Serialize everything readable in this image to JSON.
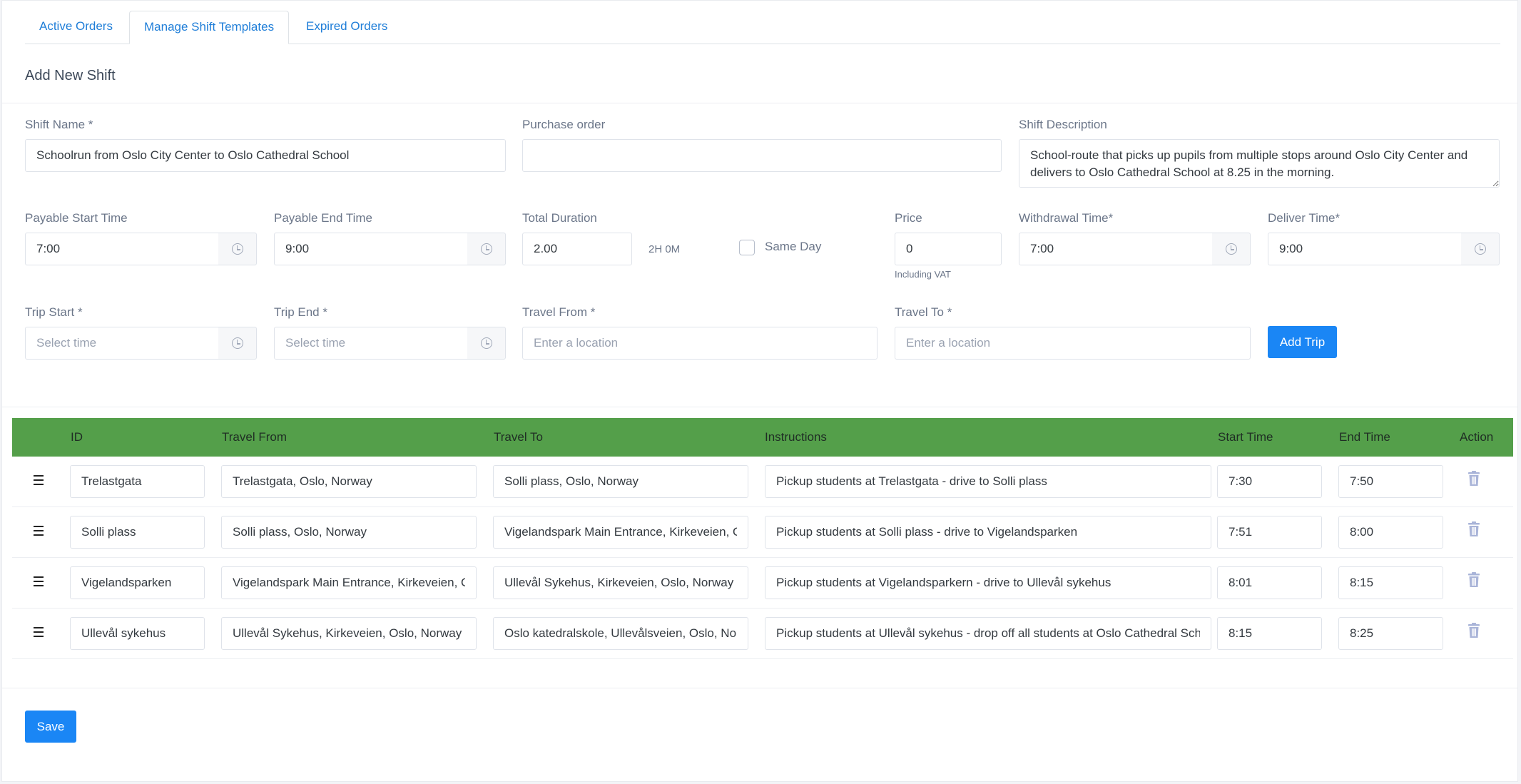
{
  "tabs": [
    {
      "label": "Active Orders",
      "active": false
    },
    {
      "label": "Manage Shift Templates",
      "active": true
    },
    {
      "label": "Expired Orders",
      "active": false
    }
  ],
  "section_title": "Add New Shift",
  "form": {
    "shift_name": {
      "label": "Shift Name *",
      "value": "Schoolrun from Oslo City Center to Oslo Cathedral School"
    },
    "purchase_order": {
      "label": "Purchase order",
      "value": ""
    },
    "shift_description": {
      "label": "Shift Description",
      "value": "School-route that picks up pupils from multiple stops around Oslo City Center and delivers to Oslo Cathedral School at 8.25 in the morning."
    },
    "payable_start": {
      "label": "Payable Start Time",
      "value": "7:00"
    },
    "payable_end": {
      "label": "Payable End Time",
      "value": "9:00"
    },
    "total_duration": {
      "label": "Total Duration",
      "value": "2.00",
      "readout": "2H 0M"
    },
    "same_day": {
      "label": "Same Day",
      "checked": false
    },
    "price": {
      "label": "Price",
      "value": "0",
      "note": "Including VAT"
    },
    "withdrawal_time": {
      "label": "Withdrawal Time*",
      "value": "7:00"
    },
    "deliver_time": {
      "label": "Deliver Time*",
      "value": "9:00"
    },
    "trip_start": {
      "label": "Trip Start *",
      "placeholder": "Select time"
    },
    "trip_end": {
      "label": "Trip End *",
      "placeholder": "Select time"
    },
    "travel_from": {
      "label": "Travel From *",
      "placeholder": "Enter a location"
    },
    "travel_to": {
      "label": "Travel To *",
      "placeholder": "Enter a location"
    },
    "add_trip_label": "Add Trip"
  },
  "table": {
    "headers": {
      "id": "ID",
      "travel_from": "Travel From",
      "travel_to": "Travel To",
      "instructions": "Instructions",
      "start": "Start Time",
      "end": "End Time",
      "action": "Action"
    },
    "rows": [
      {
        "id": "Trelastgata",
        "from": "Trelastgata, Oslo, Norway",
        "to": "Solli plass, Oslo, Norway",
        "instructions": "Pickup students at Trelastgata - drive to Solli plass",
        "start": "7:30",
        "end": "7:50"
      },
      {
        "id": "Solli plass",
        "from": "Solli plass, Oslo, Norway",
        "to": "Vigelandspark Main Entrance, Kirkeveien, Oslo, Norway",
        "instructions": "Pickup students at Solli plass - drive to Vigelandsparken",
        "start": "7:51",
        "end": "8:00"
      },
      {
        "id": "Vigelandsparken",
        "from": "Vigelandspark Main Entrance, Kirkeveien, Oslo, Norway",
        "to": "Ullevål Sykehus, Kirkeveien, Oslo, Norway",
        "instructions": "Pickup students at Vigelandsparkern - drive to Ullevål sykehus",
        "start": "8:01",
        "end": "8:15"
      },
      {
        "id": "Ullevål sykehus",
        "from": "Ullevål Sykehus, Kirkeveien, Oslo, Norway",
        "to": "Oslo katedralskole, Ullevålsveien, Oslo, Norway",
        "instructions": "Pickup students at Ullevål sykehus - drop off all students at Oslo Cathedral School",
        "start": "8:15",
        "end": "8:25"
      }
    ]
  },
  "save_label": "Save",
  "colors": {
    "accent": "#1a86f5",
    "table_header": "#549f4a",
    "link": "#1f7ed8"
  }
}
